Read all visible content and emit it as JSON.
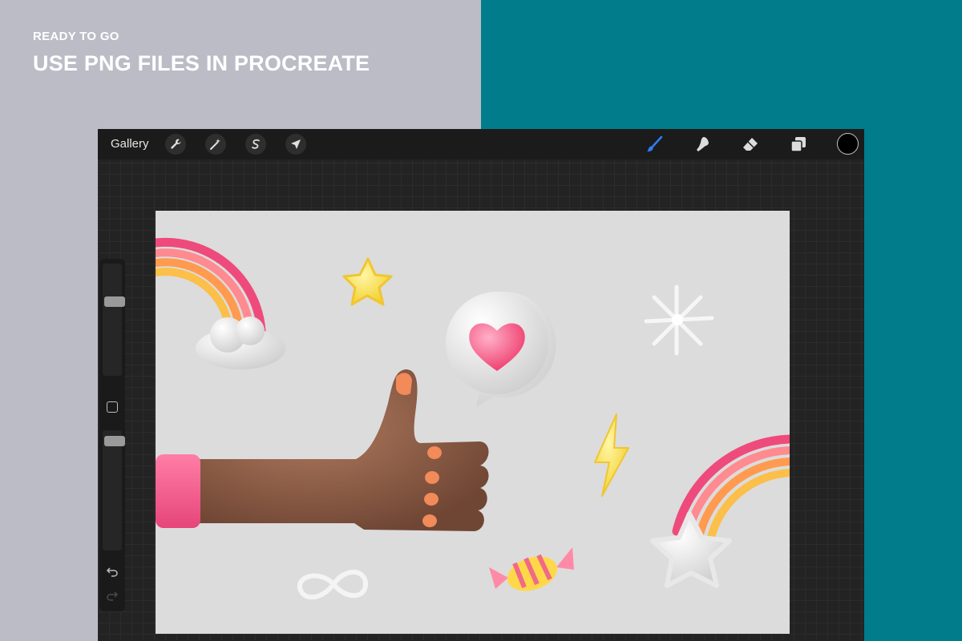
{
  "promo": {
    "kicker": "READY TO GO",
    "title": "USE PNG FILES IN PROCREATE"
  },
  "colors": {
    "left_background": "#bbbcc6",
    "right_background": "#017c8b",
    "app_background": "#232323",
    "toolbar_background": "#1b1b1b",
    "active_tool": "#2f7cf6",
    "canvas_background": "#dcdcdc",
    "current_color": "#000000"
  },
  "toolbar": {
    "gallery_label": "Gallery",
    "left_tools": [
      {
        "name": "actions",
        "icon": "wrench-icon"
      },
      {
        "name": "adjustments",
        "icon": "magic-wand-icon"
      },
      {
        "name": "selection",
        "icon": "selection-s-icon"
      },
      {
        "name": "transform",
        "icon": "arrow-cursor-icon"
      }
    ],
    "right_tools": [
      {
        "name": "brush",
        "icon": "brush-icon",
        "active": true
      },
      {
        "name": "smudge",
        "icon": "smudge-finger-icon",
        "active": false
      },
      {
        "name": "eraser",
        "icon": "eraser-icon",
        "active": false
      },
      {
        "name": "layers",
        "icon": "layers-icon",
        "active": false
      }
    ]
  },
  "sidebar": {
    "brush_size_level": 0.68,
    "opacity_level": 0.95,
    "undo_icon": "undo-icon",
    "redo_icon": "redo-icon"
  },
  "canvas_artwork": {
    "description_icons": [
      "rainbow-with-cloud",
      "star-yellow",
      "heart-speech-bubble",
      "sparkle-white",
      "thumbs-up-hand",
      "lightning-bolt",
      "rainbow-with-star",
      "infinity-symbol",
      "wrapped-candy"
    ]
  }
}
